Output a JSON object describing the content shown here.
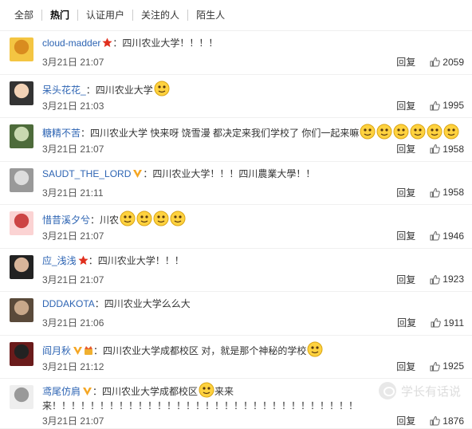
{
  "tabs": [
    "全部",
    "热门",
    "认证用户",
    "关注的人",
    "陌生人"
  ],
  "reply_label": "回复",
  "comments": [
    {
      "user": "cloud-madder",
      "badge": "star",
      "text": "：四川农业大学！！！！",
      "emoji_count": 0,
      "time": "3月21日 21:07",
      "likes": "2059"
    },
    {
      "user": "呆头花花_",
      "badge": "",
      "text": "：四川农业大学",
      "emoji_count": 1,
      "time": "3月21日 21:03",
      "likes": "1995"
    },
    {
      "user": "糖精不苦",
      "badge": "",
      "text": "：四川农业大学 快来呀 饶雪漫 都决定来我们学校了 你们一起来嘛",
      "emoji_count": 6,
      "time": "3月21日 21:07",
      "likes": "1958"
    },
    {
      "user": "SAUDT_THE_LORD",
      "badge": "v-gold",
      "text": "：四川农业大学！！！四川農業大學！！",
      "emoji_count": 0,
      "time": "3月21日 21:11",
      "likes": "1958"
    },
    {
      "user": "惜昔溪夕兮",
      "badge": "",
      "text": "：川农",
      "emoji_count": 4,
      "time": "3月21日 21:07",
      "likes": "1946"
    },
    {
      "user": "应_浅浅",
      "badge": "star",
      "text": "：四川农业大学！！！",
      "emoji_count": 0,
      "time": "3月21日 21:07",
      "likes": "1923"
    },
    {
      "user": "DDDAKOTA",
      "badge": "",
      "text": "：四川农业大学么么大",
      "emoji_count": 0,
      "time": "3月21日 21:06",
      "likes": "1911"
    },
    {
      "user": "阎月秋",
      "badge": "v-gold-crown",
      "text": "：四川农业大学成都校区 对，就是那个神秘的学校",
      "emoji_count": 1,
      "time": "3月21日 21:12",
      "likes": "1925"
    },
    {
      "user": "鸢尾仿肩",
      "badge": "v-gold",
      "text": "：四川农业大学成都校区",
      "text_after_emoji": "来来",
      "text_line2": "来！！！！！！！！！！！！！！！！！！！！！！！！！！！！！！！！",
      "emoji_count": 1,
      "time": "3月21日 21:07",
      "likes": "1876"
    }
  ],
  "watermark": "学长有话说",
  "colors": {
    "link": "#2d64b3",
    "star": "#e0301e",
    "vip": "#f5a623"
  }
}
